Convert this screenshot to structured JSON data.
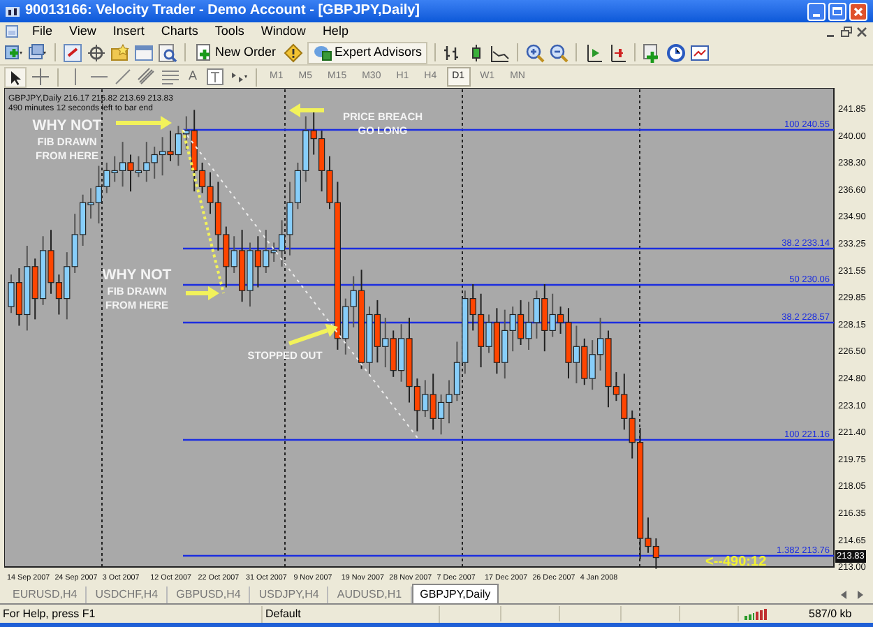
{
  "window": {
    "title": "90013166: Velocity Trader - Demo Account - [GBPJPY,Daily]"
  },
  "menu": [
    "File",
    "View",
    "Insert",
    "Charts",
    "Tools",
    "Window",
    "Help"
  ],
  "toolbar": {
    "buttons": [
      "New Order",
      "Expert Advisors"
    ],
    "text_tool": "A"
  },
  "periods": [
    {
      "label": "M1",
      "selected": false
    },
    {
      "label": "M5",
      "selected": false
    },
    {
      "label": "M15",
      "selected": false
    },
    {
      "label": "M30",
      "selected": false
    },
    {
      "label": "H1",
      "selected": false
    },
    {
      "label": "H4",
      "selected": false
    },
    {
      "label": "D1",
      "selected": true
    },
    {
      "label": "W1",
      "selected": false
    },
    {
      "label": "MN",
      "selected": false
    }
  ],
  "chart": {
    "info": [
      "GBPJPY,Daily  216.17 216.82 213.69 213.83",
      "490 minutes 12 seconds left to bar end"
    ],
    "price_axis": [
      "241.85",
      "240.00",
      "238.30",
      "236.60",
      "234.90",
      "233.25",
      "231.55",
      "229.85",
      "228.15",
      "226.50",
      "224.80",
      "223.10",
      "221.40",
      "219.75",
      "218.05",
      "216.35",
      "214.65",
      "213.00"
    ],
    "current_price": "213.83",
    "date_axis": [
      "14 Sep 2007",
      "24 Sep 2007",
      "3 Oct 2007",
      "12 Oct 2007",
      "22 Oct 2007",
      "31 Oct 2007",
      "9 Nov 2007",
      "19 Nov 2007",
      "28 Nov 2007",
      "7 Dec 2007",
      "17 Dec 2007",
      "26 Dec 2007",
      "4 Jan 2008"
    ],
    "fib_levels": [
      "100  240.55",
      "38.2  233.14",
      "50  230.06",
      "38.2  228.57",
      "100  221.16",
      "1.382  213.76"
    ],
    "annotations": [
      {
        "lines": [
          "WHY NOT",
          "FIB DRAWN",
          "FROM HERE"
        ]
      },
      {
        "lines": [
          "WHY NOT",
          "FIB DRAWN",
          "FROM HERE"
        ]
      },
      {
        "lines": [
          "PRICE BREACH",
          "GO LONG"
        ]
      },
      {
        "lines": [
          "STOPPED OUT"
        ]
      }
    ],
    "countdown": "<--490:12"
  },
  "tabs": [
    {
      "label": "EURUSD,H4",
      "selected": false
    },
    {
      "label": "USDCHF,H4",
      "selected": false
    },
    {
      "label": "GBPUSD,H4",
      "selected": false
    },
    {
      "label": "USDJPY,H4",
      "selected": false
    },
    {
      "label": "AUDUSD,H1",
      "selected": false
    },
    {
      "label": "GBPJPY,Daily",
      "selected": true
    }
  ],
  "status_bar": [
    "For Help, press F1",
    "Default",
    "587/0 kb"
  ]
}
